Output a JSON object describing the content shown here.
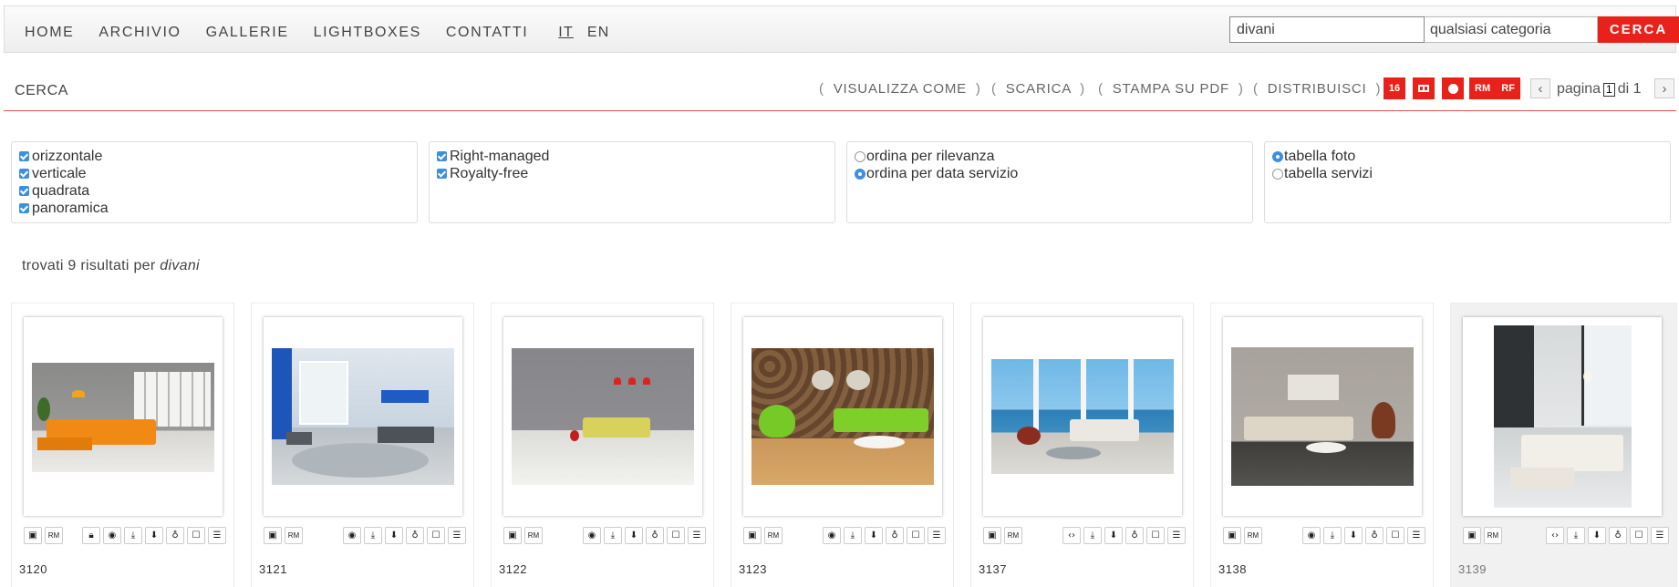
{
  "nav": {
    "links": [
      "HOME",
      "ARCHIVIO",
      "GALLERIE",
      "LIGHTBOXES",
      "CONTATTI"
    ],
    "lang_it": "IT",
    "lang_en": "EN"
  },
  "search": {
    "value": "divani",
    "category": "qualsiasi categoria",
    "button": "CERCA"
  },
  "toolbar": {
    "title": "CERCA",
    "visualizza": "VISUALIZZA COME",
    "scarica": "SCARICA",
    "stampa": "STAMPA SU PDF",
    "distribuisci": "DISTRIBUISCI",
    "bracket_open": "(",
    "bracket_close": ")",
    "per_page": "16",
    "rm": "RM",
    "rf": "RF",
    "pagina": "pagina",
    "page_num": "1",
    "di": "di 1",
    "prev_icon": "‹",
    "next_icon": "›"
  },
  "filters": {
    "orientation": [
      {
        "label": "orizzontale",
        "checked": true
      },
      {
        "label": "verticale",
        "checked": true
      },
      {
        "label": "quadrata",
        "checked": true
      },
      {
        "label": "panoramica",
        "checked": true
      }
    ],
    "license": [
      {
        "label": "Right-managed",
        "checked": true
      },
      {
        "label": "Royalty-free",
        "checked": true
      }
    ],
    "sort": [
      {
        "label": "ordina per rilevanza",
        "selected": false
      },
      {
        "label": "ordina per data servizio",
        "selected": true
      }
    ],
    "view": [
      {
        "label": "tabella foto",
        "selected": true
      },
      {
        "label": "tabella servizi",
        "selected": false
      }
    ]
  },
  "results": {
    "prefix": "trovati 9 risultati per",
    "query": "divani"
  },
  "cards": [
    {
      "id": "3120",
      "rm": "RM",
      "icons": [
        "lock-icon",
        "eye-icon",
        "download-icon",
        "download-alt-icon",
        "bulb-icon",
        "square-icon",
        "menu-icon"
      ]
    },
    {
      "id": "3121",
      "rm": "RM",
      "icons": [
        "eye-icon",
        "download-icon",
        "download-alt-icon",
        "bulb-icon",
        "square-icon",
        "menu-icon"
      ]
    },
    {
      "id": "3122",
      "rm": "RM",
      "icons": [
        "eye-icon",
        "download-icon",
        "download-alt-icon",
        "bulb-icon",
        "square-icon",
        "menu-icon"
      ]
    },
    {
      "id": "3123",
      "rm": "RM",
      "icons": [
        "eye-icon",
        "download-icon",
        "download-alt-icon",
        "bulb-icon",
        "square-icon",
        "menu-icon"
      ]
    },
    {
      "id": "3137",
      "rm": "RM",
      "icons": [
        "code-icon",
        "download-icon",
        "download-alt-icon",
        "bulb-icon",
        "square-icon",
        "menu-icon"
      ]
    },
    {
      "id": "3138",
      "rm": "RM",
      "icons": [
        "eye-icon",
        "download-icon",
        "download-alt-icon",
        "bulb-icon",
        "square-icon",
        "menu-icon"
      ]
    },
    {
      "id": "3139",
      "rm": "RM",
      "icons": [
        "code-icon",
        "download-icon",
        "download-alt-icon",
        "bulb-icon",
        "square-icon",
        "menu-icon"
      ]
    }
  ]
}
